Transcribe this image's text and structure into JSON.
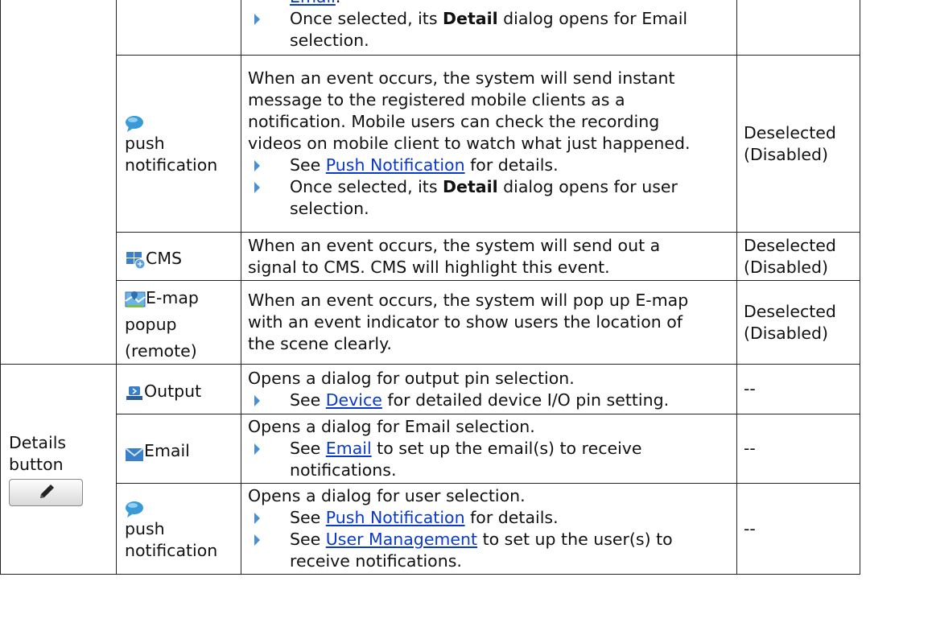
{
  "row_email_cont": {
    "link": "Email",
    "after_link": ".",
    "b1_pre": "Once selected, its ",
    "b1_bold": "Detail",
    "b1_post": " dialog opens for Email",
    "b1_line2": "selection."
  },
  "row_push": {
    "name": "push notification",
    "desc_lines": [
      "When an event occurs, the system will send instant",
      "message to the registered mobile clients as a",
      "notification. Mobile users can check the recording",
      "videos on mobile client to watch what just happened."
    ],
    "b1_pre": "See ",
    "b1_link": "Push Notification",
    "b1_post": " for details.",
    "b2_pre": "Once selected, its ",
    "b2_bold": "Detail",
    "b2_post": " dialog opens for user",
    "b2_line2": "selection.",
    "default_line1": "Deselected",
    "default_line2": "(Disabled)"
  },
  "row_cms": {
    "name": "CMS",
    "desc_lines": [
      "When an event occurs, the system will send out a",
      "signal to CMS. CMS will highlight this event."
    ],
    "default_line1": "Deselected",
    "default_line2": "(Disabled)"
  },
  "row_emap": {
    "name": "E-map popup (remote)",
    "desc_lines": [
      "When an event occurs, the system will pop up E-map",
      "with an event indicator to show users the location of",
      "the scene clearly."
    ],
    "default_line1": "Deselected",
    "default_line2": "(Disabled)"
  },
  "details": {
    "label": "Details button",
    "icon": "pencil-icon"
  },
  "row_output": {
    "name": "Output",
    "line1": "Opens a dialog for output pin selection.",
    "b1_pre": "See ",
    "b1_link": "Device",
    "b1_post": " for detailed device I/O pin setting.",
    "default": "--"
  },
  "row_email": {
    "name": "Email",
    "line1": "Opens a dialog for Email selection.",
    "b1_pre": "See ",
    "b1_link": "Email",
    "b1_post": " to set up the email(s) to receive",
    "b1_line2": "notifications.",
    "default": "--"
  },
  "row_push2": {
    "name": "push notification",
    "line1": "Opens a dialog for user selection.",
    "b1_pre": "See ",
    "b1_link": "Push Notification",
    "b1_post": " for details.",
    "b2_pre": "See ",
    "b2_link": "User Management",
    "b2_post": " to set up the user(s) to",
    "b2_line2": "receive notifications.",
    "default": "--"
  },
  "colors": {
    "link": "#0a3acb",
    "bullet": "#4a90d0",
    "border": "#222222"
  }
}
